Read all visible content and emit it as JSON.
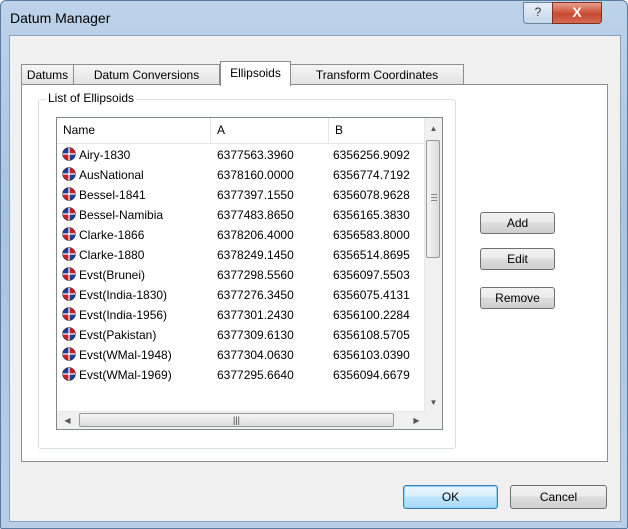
{
  "window": {
    "title": "Datum Manager",
    "help_glyph": "?",
    "close_glyph": "X"
  },
  "tabs": [
    {
      "label": "Datums",
      "active": false
    },
    {
      "label": "Datum Conversions",
      "active": false
    },
    {
      "label": "Ellipsoids",
      "active": true
    },
    {
      "label": "Transform Coordinates",
      "active": false
    }
  ],
  "group": {
    "label": "List of Ellipsoids"
  },
  "list": {
    "columns": [
      "Name",
      "A",
      "B"
    ],
    "rows": [
      {
        "icon": "globe-icon",
        "name": "Airy-1830",
        "a": "6377563.3960",
        "b": "6356256.9092"
      },
      {
        "icon": "globe-icon",
        "name": "AusNational",
        "a": "6378160.0000",
        "b": "6356774.7192"
      },
      {
        "icon": "globe-icon",
        "name": "Bessel-1841",
        "a": "6377397.1550",
        "b": "6356078.9628"
      },
      {
        "icon": "globe-icon",
        "name": "Bessel-Namibia",
        "a": "6377483.8650",
        "b": "6356165.3830"
      },
      {
        "icon": "globe-icon",
        "name": "Clarke-1866",
        "a": "6378206.4000",
        "b": "6356583.8000"
      },
      {
        "icon": "globe-icon",
        "name": "Clarke-1880",
        "a": "6378249.1450",
        "b": "6356514.8695"
      },
      {
        "icon": "globe-icon",
        "name": "Evst(Brunei)",
        "a": "6377298.5560",
        "b": "6356097.5503"
      },
      {
        "icon": "globe-icon",
        "name": "Evst(India-1830)",
        "a": "6377276.3450",
        "b": "6356075.4131"
      },
      {
        "icon": "globe-icon",
        "name": "Evst(India-1956)",
        "a": "6377301.2430",
        "b": "6356100.2284"
      },
      {
        "icon": "globe-icon",
        "name": "Evst(Pakistan)",
        "a": "6377309.6130",
        "b": "6356108.5705"
      },
      {
        "icon": "globe-icon",
        "name": "Evst(WMal-1948)",
        "a": "6377304.0630",
        "b": "6356103.0390"
      },
      {
        "icon": "globe-icon",
        "name": "Evst(WMal-1969)",
        "a": "6377295.6640",
        "b": "6356094.6679"
      }
    ]
  },
  "side_buttons": {
    "add": "Add",
    "edit": "Edit",
    "remove": "Remove"
  },
  "footer_buttons": {
    "ok": "OK",
    "cancel": "Cancel"
  },
  "colors": {
    "globe_red": "#c8202a",
    "globe_blue": "#1f3f96",
    "accent": "#3c7fb1"
  }
}
